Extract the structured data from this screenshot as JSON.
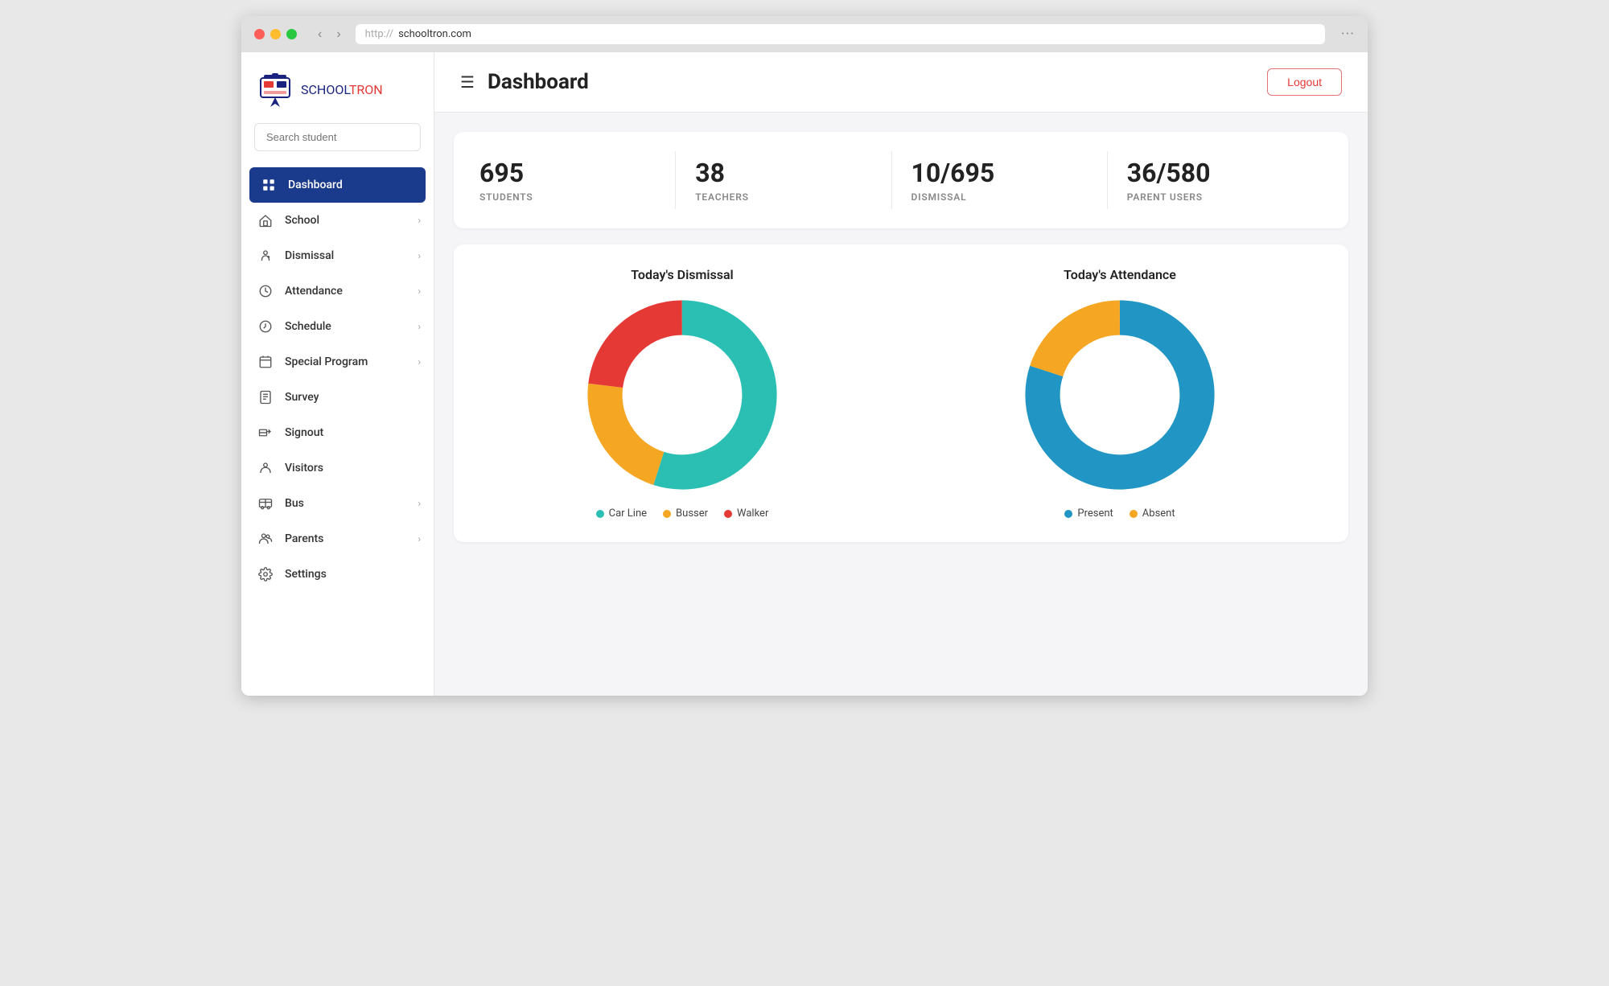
{
  "browser": {
    "protocol": "http://",
    "url": "schooltron.com",
    "menu": "···"
  },
  "sidebar": {
    "logo_school": "SCHOOL",
    "logo_tron": "TRON",
    "search_placeholder": "Search student",
    "nav_items": [
      {
        "id": "dashboard",
        "label": "Dashboard",
        "icon": "grid",
        "active": true,
        "has_chevron": false
      },
      {
        "id": "school",
        "label": "School",
        "icon": "school",
        "active": false,
        "has_chevron": true
      },
      {
        "id": "dismissal",
        "label": "Dismissal",
        "icon": "dismissal",
        "active": false,
        "has_chevron": true
      },
      {
        "id": "attendance",
        "label": "Attendance",
        "icon": "clock",
        "active": false,
        "has_chevron": true
      },
      {
        "id": "schedule",
        "label": "Schedule",
        "icon": "schedule",
        "active": false,
        "has_chevron": true
      },
      {
        "id": "special-program",
        "label": "Special Program",
        "icon": "calendar",
        "active": false,
        "has_chevron": true
      },
      {
        "id": "survey",
        "label": "Survey",
        "icon": "survey",
        "active": false,
        "has_chevron": false
      },
      {
        "id": "signout",
        "label": "Signout",
        "icon": "signout",
        "active": false,
        "has_chevron": false
      },
      {
        "id": "visitors",
        "label": "Visitors",
        "icon": "visitors",
        "active": false,
        "has_chevron": false
      },
      {
        "id": "bus",
        "label": "Bus",
        "icon": "bus",
        "active": false,
        "has_chevron": true
      },
      {
        "id": "parents",
        "label": "Parents",
        "icon": "parents",
        "active": false,
        "has_chevron": true
      },
      {
        "id": "settings",
        "label": "Settings",
        "icon": "settings",
        "active": false,
        "has_chevron": false
      }
    ]
  },
  "header": {
    "title": "Dashboard",
    "logout_label": "Logout"
  },
  "stats": [
    {
      "value": "695",
      "label": "STUDENTS"
    },
    {
      "value": "38",
      "label": "TEACHERS"
    },
    {
      "value": "10/695",
      "label": "DISMISSAL"
    },
    {
      "value": "36/580",
      "label": "PARENT USERS"
    }
  ],
  "charts": {
    "dismissal": {
      "title": "Today's Dismissal",
      "segments": [
        {
          "label": "Car Line",
          "value": 55,
          "color": "#2bbfb3"
        },
        {
          "label": "Busser",
          "value": 22,
          "color": "#f5a623"
        },
        {
          "label": "Walker",
          "value": 23,
          "color": "#e53935"
        }
      ]
    },
    "attendance": {
      "title": "Today's Attendance",
      "segments": [
        {
          "label": "Present",
          "value": 80,
          "color": "#2196c4"
        },
        {
          "label": "Absent",
          "value": 20,
          "color": "#f5a623"
        }
      ]
    }
  }
}
